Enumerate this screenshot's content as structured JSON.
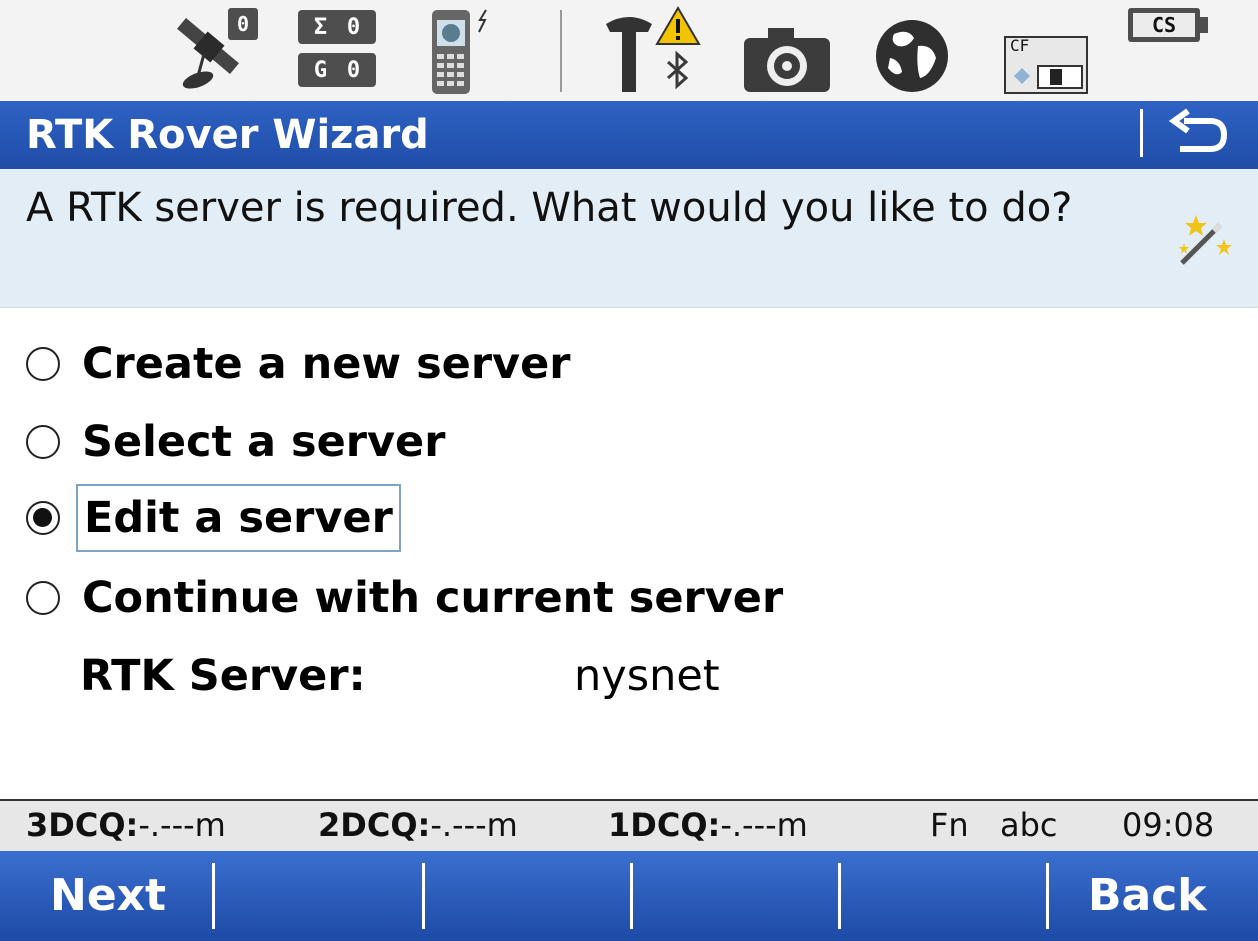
{
  "statusbar": {
    "sat_count": "0",
    "sigma_label": "Σ",
    "sigma_value": "0",
    "g_label": "G",
    "g_value": "0",
    "memory_card": "CF",
    "battery_label": "CS",
    "icons": [
      "satellite-icon",
      "solution-counter-icon",
      "phone-icon",
      "antenna-icon",
      "warning-icon",
      "bluetooth-icon",
      "camera-icon",
      "globe-icon",
      "cf-card-icon",
      "battery-icon"
    ]
  },
  "titlebar": {
    "title": "RTK Rover Wizard",
    "undo_icon": "undo-icon"
  },
  "prompt": {
    "text": "A RTK server is required. What would you like to do?",
    "icon": "wizard-wand-icon"
  },
  "options": [
    {
      "label": "Create a new server",
      "selected": false
    },
    {
      "label": "Select a server",
      "selected": false
    },
    {
      "label": "Edit a server",
      "selected": true
    },
    {
      "label": "Continue with current server",
      "selected": false
    }
  ],
  "server": {
    "label": "RTK Server:",
    "value": "nysnet"
  },
  "quality": {
    "q3_label": "3DCQ:",
    "q3_value": "-.---m",
    "q2_label": "2DCQ:",
    "q2_value": "-.---m",
    "q1_label": "1DCQ:",
    "q1_value": "-.---m",
    "fn": "Fn",
    "input_mode": "abc",
    "time": "09:08"
  },
  "softkeys": {
    "next": "Next",
    "back": "Back"
  },
  "colors": {
    "title_blue": "#2f62c4",
    "prompt_bg": "#e3edf6",
    "softkey_blue": "#1d4aa6"
  }
}
